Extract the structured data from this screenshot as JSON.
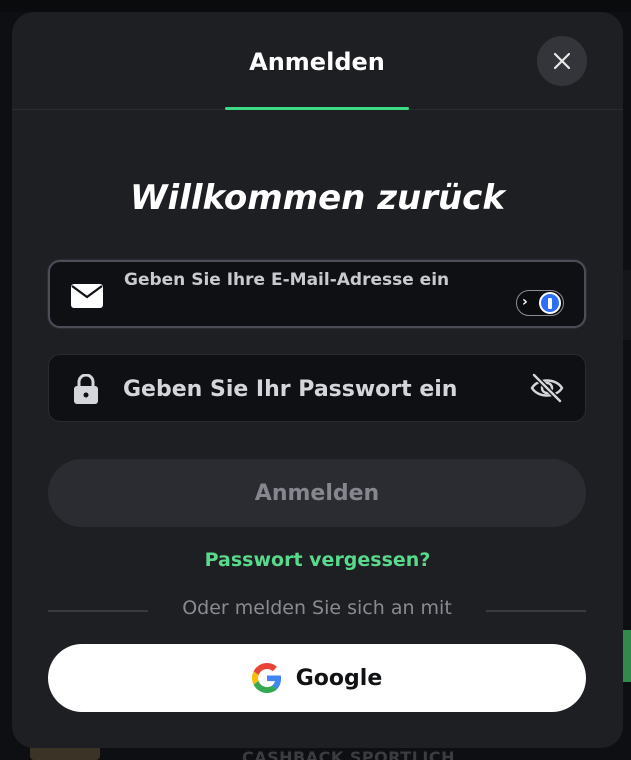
{
  "background": {
    "bottom_text": "CASHBACK SPORTLICH"
  },
  "modal": {
    "tab_label": "Anmelden",
    "headline": "Willkommen zurück",
    "email": {
      "label": "Geben Sie Ihre E-Mail-Adresse ein",
      "value": ""
    },
    "password": {
      "placeholder": "Geben Sie Ihr Passwort ein"
    },
    "submit_label": "Anmelden",
    "forgot_password": "Passwort vergessen?",
    "divider_text": "Oder melden Sie sich an mit",
    "google_label": "Google"
  },
  "icons": {
    "close": "close-icon",
    "email": "mail-icon",
    "lock": "lock-icon",
    "eye": "eye-slash-icon",
    "password_manager": "password-manager-icon",
    "google": "google-logo-icon"
  },
  "colors": {
    "accent": "#3ddc84",
    "link": "#59d98c",
    "modal_bg": "#1e1f23"
  }
}
